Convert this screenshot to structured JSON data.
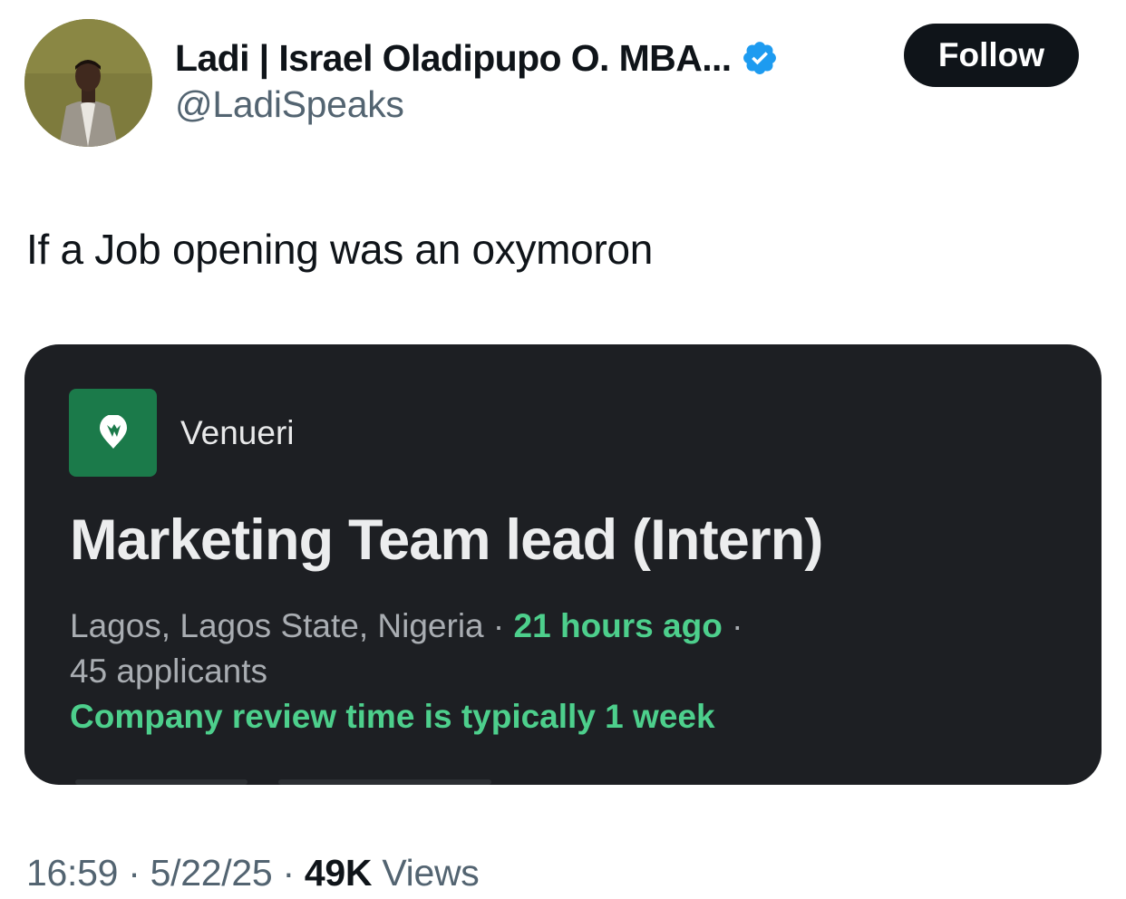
{
  "author": {
    "display_name": "Ladi | Israel Oladipupo O. MBA...",
    "handle": "@LadiSpeaks",
    "verified_icon": "verified-badge-icon",
    "verified_color": "#1d9bf0"
  },
  "follow_button": {
    "label": "Follow"
  },
  "tweet": {
    "text": "If a Job opening was an oxymoron"
  },
  "job_card": {
    "company": "Venueri",
    "company_logo_color": "#1b7a4a",
    "title": "Marketing Team lead (Intern)",
    "location": "Lagos, Lagos State, Nigeria",
    "separator": "·",
    "posted": "21 hours ago",
    "applicants": "45 applicants",
    "review_time": "Company review time is typically 1 week",
    "accent_color": "#4dcf8c"
  },
  "footer": {
    "time": "16:59",
    "date": "5/22/25",
    "separator": "·",
    "views_count": "49K",
    "views_label": "Views"
  }
}
